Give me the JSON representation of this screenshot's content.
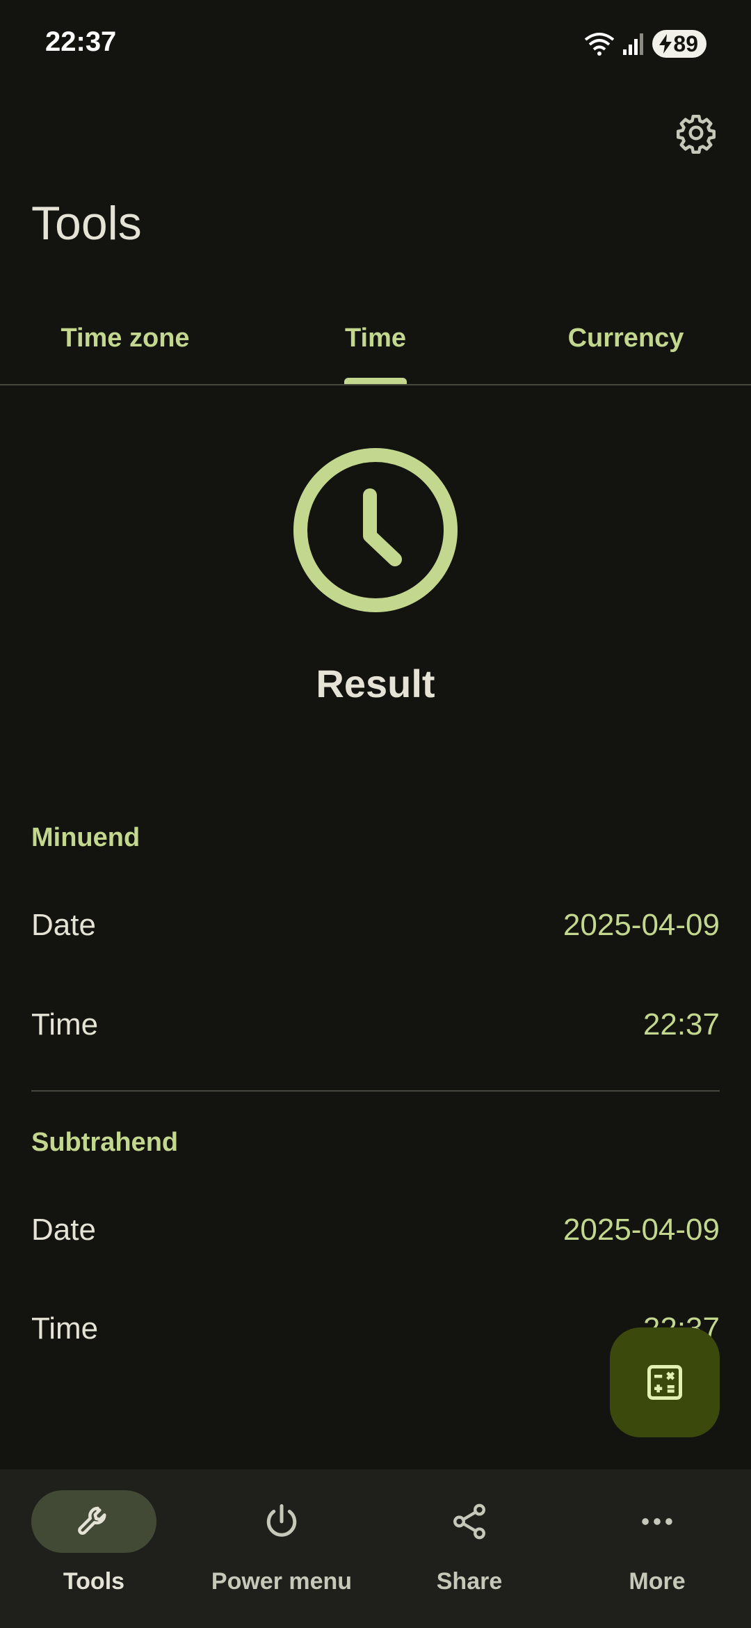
{
  "status_bar": {
    "time": "22:37",
    "battery": "89"
  },
  "header": {
    "title": "Tools"
  },
  "tabs": [
    {
      "label": "Time zone",
      "selected": false
    },
    {
      "label": "Time",
      "selected": true
    },
    {
      "label": "Currency",
      "selected": false
    }
  ],
  "result": {
    "title": "Result"
  },
  "minuend": {
    "label": "Minuend",
    "date_label": "Date",
    "date_value": "2025-04-09",
    "time_label": "Time",
    "time_value": "22:37"
  },
  "subtrahend": {
    "label": "Subtrahend",
    "date_label": "Date",
    "date_value": "2025-04-09",
    "time_label": "Time",
    "time_value": "22:37"
  },
  "bottom_nav": [
    {
      "label": "Tools",
      "icon": "wrench-icon",
      "active": true
    },
    {
      "label": "Power menu",
      "icon": "power-icon",
      "active": false
    },
    {
      "label": "Share",
      "icon": "share-icon",
      "active": false
    },
    {
      "label": "More",
      "icon": "more-horiz-icon",
      "active": false
    }
  ],
  "colors": {
    "background": "#13140f",
    "accent": "#c3d88e",
    "fab": "#3b4a0c",
    "nav_background": "#1f201b"
  }
}
